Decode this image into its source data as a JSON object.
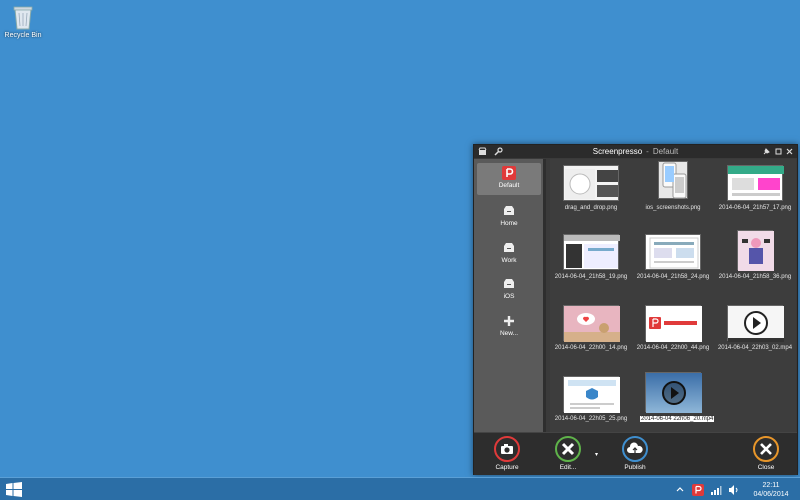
{
  "desktop": {
    "recycle_bin_label": "Recycle Bin",
    "background_color": "#3f8fcf"
  },
  "window": {
    "app_name": "Screenpresso",
    "separator": "-",
    "workspace": "Default"
  },
  "sidebar": {
    "items": [
      {
        "label": "Default",
        "icon": "screenpresso-logo-icon",
        "active": true
      },
      {
        "label": "Home",
        "icon": "folder-box-icon"
      },
      {
        "label": "Work",
        "icon": "folder-box-icon"
      },
      {
        "label": "iOS",
        "icon": "folder-box-icon"
      },
      {
        "label": "New...",
        "icon": "plus-icon"
      }
    ]
  },
  "gallery": {
    "items": [
      {
        "name": "drag_and_drop.png"
      },
      {
        "name": "ios_screenshots.png"
      },
      {
        "name": "2014-06-04_21h57_17.png"
      },
      {
        "name": "2014-06-04_21h58_19.png"
      },
      {
        "name": "2014-06-04_21h58_24.png"
      },
      {
        "name": "2014-06-04_21h58_36.png"
      },
      {
        "name": "2014-06-04_22h00_14.png"
      },
      {
        "name": "2014-06-04_22h00_44.png"
      },
      {
        "name": "2014-06-04_22h03_02.mp4"
      },
      {
        "name": "2014-06-04_22h05_25.png"
      },
      {
        "name": "2014-06-04 22h06_20.mp4",
        "selected": true
      }
    ]
  },
  "actions": {
    "capture": {
      "label": "Capture",
      "color": "#e03a3a"
    },
    "edit": {
      "label": "Edit...",
      "color": "#5fb34a"
    },
    "dropdown": "▾",
    "publish": {
      "label": "Publish",
      "color": "#3f8fcf"
    },
    "close": {
      "label": "Close",
      "color": "#e8962a"
    }
  },
  "taskbar": {
    "time": "22:11",
    "date": "04/06/2014"
  }
}
